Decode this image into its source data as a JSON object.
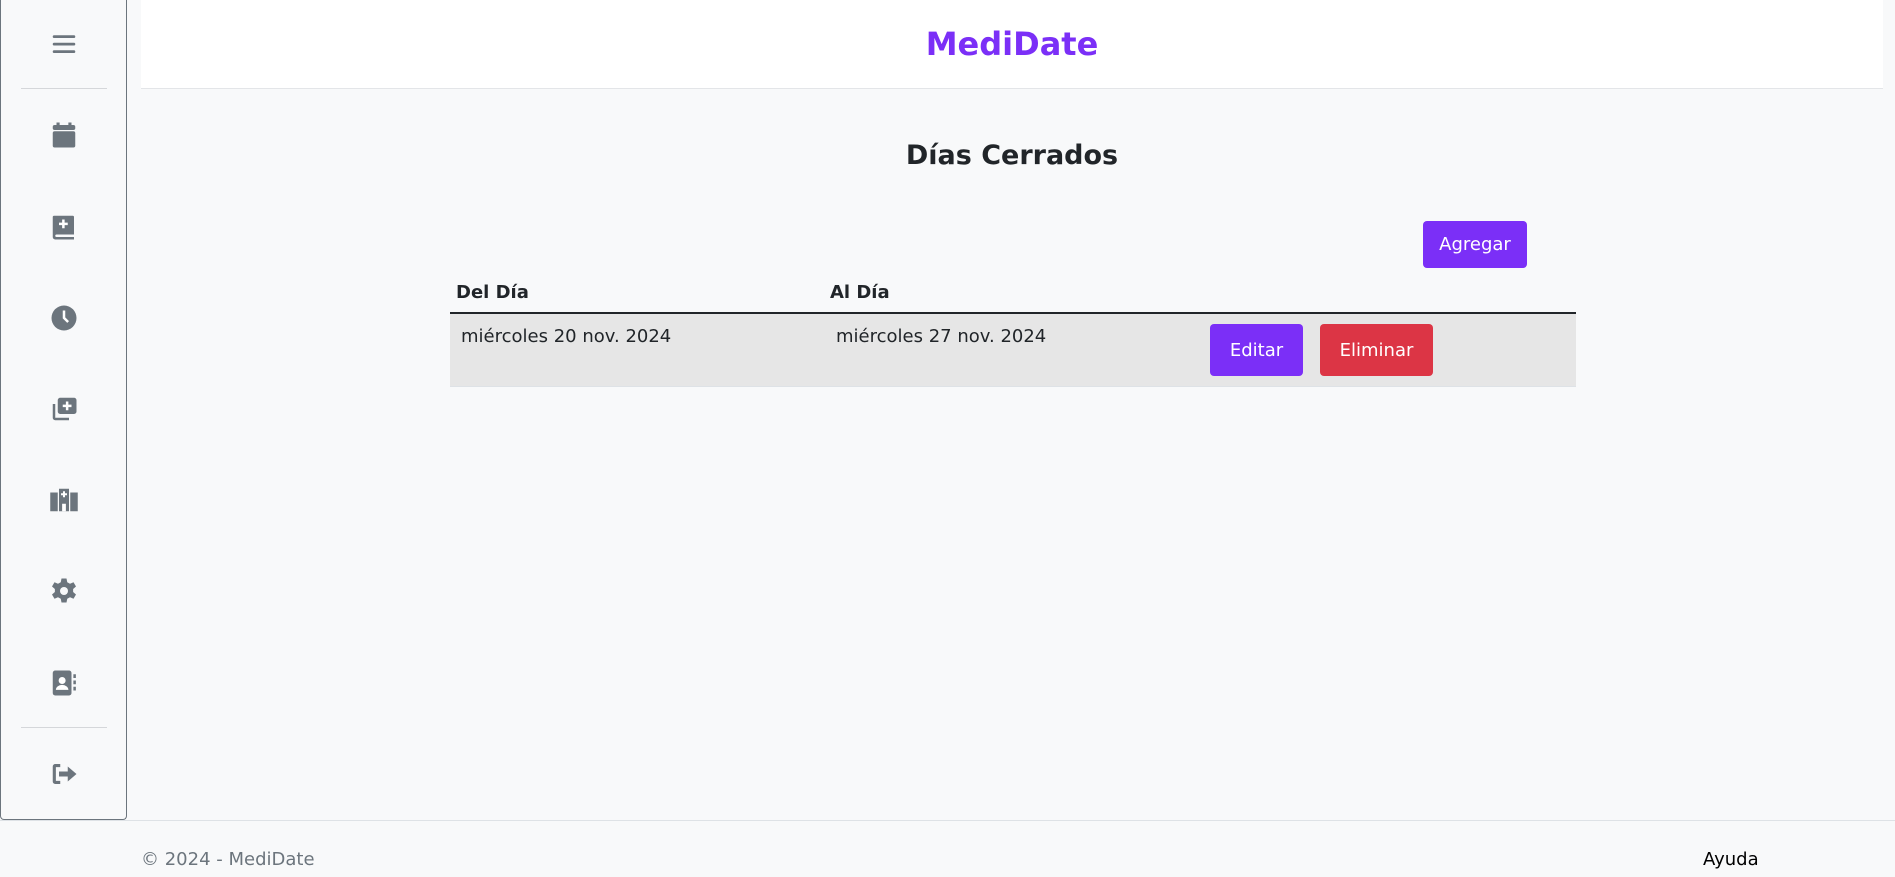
{
  "app": {
    "title": "MediDate"
  },
  "sidebar": {
    "items": [
      {
        "icon": "menu-icon"
      },
      {
        "icon": "calendar-icon"
      },
      {
        "icon": "medical-book-icon"
      },
      {
        "icon": "clock-icon"
      },
      {
        "icon": "add-copy-icon"
      },
      {
        "icon": "hospital-icon"
      },
      {
        "icon": "gear-icon"
      },
      {
        "icon": "contact-card-icon"
      },
      {
        "icon": "logout-icon"
      }
    ]
  },
  "main": {
    "title": "Días Cerrados",
    "add_label": "Agregar",
    "columns": [
      "Del Día",
      "Al Día"
    ],
    "rows": [
      {
        "from": "miércoles 20 nov. 2024",
        "to": "miércoles 27 nov. 2024",
        "edit_label": "Editar",
        "delete_label": "Eliminar"
      }
    ]
  },
  "footer": {
    "copyright": "© 2024 - MediDate",
    "help": "Ayuda"
  },
  "colors": {
    "accent": "#7b2ff7",
    "danger": "#dc3545",
    "icon": "#6c757d"
  }
}
